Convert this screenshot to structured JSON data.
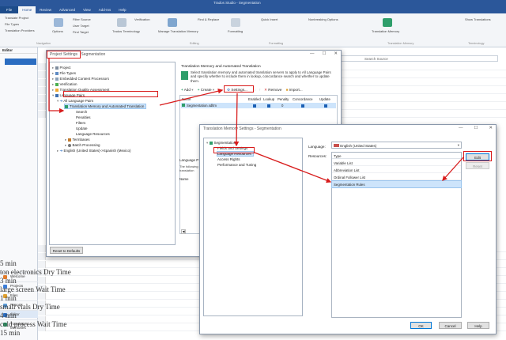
{
  "app": {
    "window_title": "Trados Studio - Segmentation",
    "ribbon_tabs": [
      "File",
      "Home",
      "Review",
      "Advanced",
      "View",
      "Add-Ins",
      "Help"
    ],
    "ribbon_items": [
      "Translate Project",
      "File Types",
      "Translation Providers",
      "Options",
      "Filter Source",
      "User Target",
      "Find Target",
      "Trados Terminology",
      "Verification",
      "Manage Translation Memory",
      "Find & Replace",
      "Formatting",
      "Quick Insert",
      "Nonbreaking Options",
      "Translation Memory",
      "Show Translations"
    ],
    "ribbon_groups": [
      "Navigation",
      "Editing",
      "Formatting",
      "Translation Memory",
      "Terminology"
    ],
    "editor_label": "Editor",
    "search_placeholder": "Search Source",
    "nav_items": [
      "Welcome",
      "Projects",
      "Files",
      "Reports",
      "Editor",
      "Translation Memories"
    ],
    "editor_lines": [
      "5 min",
      "ton   electronics   Dry Time",
      "3 min",
      "large screen   Wait Time",
      "1 min",
      "small vials   Dry Time",
      "4 min",
      "cold process   Wait Time",
      "15 min"
    ]
  },
  "project_settings": {
    "title": "Project Settings",
    "subtitle": "Segmentation",
    "tree": {
      "project": "Project",
      "file_types": "File Types",
      "embedded": "Embedded Content Processors",
      "verification": "Verification",
      "tqa": "Translation Quality Assessment",
      "language_pairs": "Language Pairs",
      "all_pairs": "All Language Pairs",
      "tm_automated": "Translation Memory and Automated Translation",
      "search": "Search",
      "penalties": "Penalties",
      "filters": "Filters",
      "update": "Update",
      "language_resources": "Language Resources",
      "termbases": "Termbases",
      "batch": "Batch Processing",
      "en_es": "English (United States)->Spanish (Mexico)"
    },
    "panel_title": "Translation Memory and Automated Translation",
    "panel_desc": "Select translation memory and automated translation servers to apply to All Language Pairs and specify whether to include them in lookup, concordance search and whether to update them.",
    "toolbar": {
      "add": "Add",
      "create": "Create",
      "settings": "Settings...",
      "remove": "Remove",
      "import": "Import..."
    },
    "columns": [
      "Name",
      "Enabled",
      "Lookup",
      "Penalty",
      "Concordance",
      "Update"
    ],
    "row": {
      "name": "Segmentation.sdltm",
      "penalty": "0"
    },
    "lower_label": "Language P",
    "lower_text": "The following translation memories... Pairs. Reve",
    "lower_col": "Name",
    "reset_button": "Reset to Defaults"
  },
  "tm_settings": {
    "title": "Translation Memory Settings - Segmentation",
    "tree": {
      "root": "Segmentation",
      "fields": "Fields and Settings",
      "language_resources": "Language Resources",
      "access_rights": "Access Rights",
      "performance": "Performance and Tuning"
    },
    "language_label": "Language:",
    "language_value": "English (United States)",
    "resources_label": "Resources:",
    "type_header": "Type",
    "resources": [
      "Variable List",
      "Abbreviation List",
      "Ordinal Follower List",
      "Segmentation Rules"
    ],
    "edit_button": "Edit",
    "reset_button": "Reset",
    "ok_button": "OK",
    "cancel_button": "Cancel",
    "help_button": "Help"
  },
  "colors": {
    "accent": "#2b579a",
    "highlight_red": "#d81b1b",
    "selection": "#cde4fb"
  }
}
